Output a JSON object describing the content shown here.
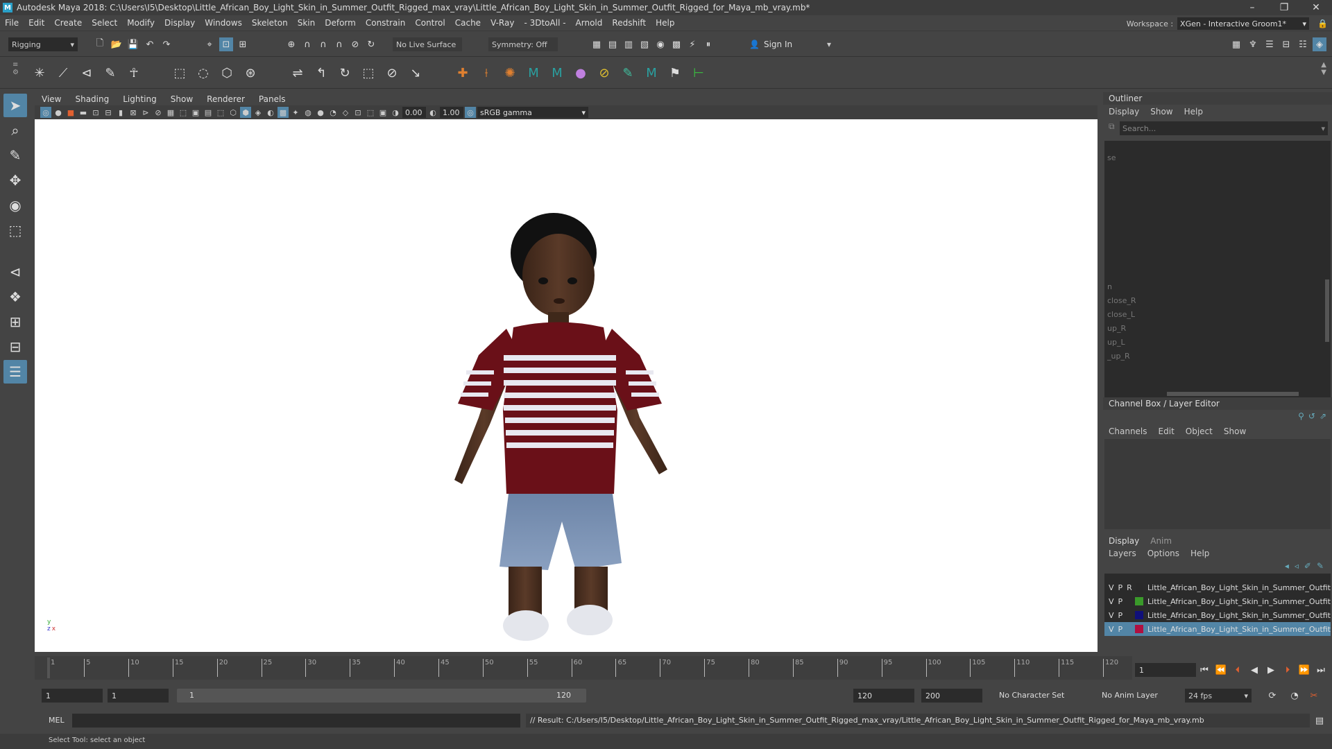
{
  "title": "Autodesk Maya 2018: C:\\Users\\I5\\Desktop\\Little_African_Boy_Light_Skin_in_Summer_Outfit_Rigged_max_vray\\Little_African_Boy_Light_Skin_in_Summer_Outfit_Rigged_for_Maya_mb_vray.mb*",
  "window_controls": {
    "minimize": "–",
    "restore": "❐",
    "close": "✕"
  },
  "menu": [
    "File",
    "Edit",
    "Create",
    "Select",
    "Modify",
    "Display",
    "Windows",
    "Skeleton",
    "Skin",
    "Deform",
    "Constrain",
    "Control",
    "Cache",
    "V-Ray",
    "- 3DtoAll -",
    "Arnold",
    "Redshift",
    "Help"
  ],
  "workspace": {
    "label": "Workspace :",
    "value": "XGen - Interactive Groom1*"
  },
  "status": {
    "mode": "Rigging",
    "live_surface": "No Live Surface",
    "symmetry": "Symmetry: Off",
    "sign_in": "Sign In"
  },
  "panel_menu": [
    "View",
    "Shading",
    "Lighting",
    "Show",
    "Renderer",
    "Panels"
  ],
  "panel_tools": {
    "exposure": "0.00",
    "gamma": "1.00",
    "color_space": "sRGB gamma"
  },
  "outliner": {
    "title": "Outliner",
    "menu": [
      "Display",
      "Show",
      "Help"
    ],
    "search_placeholder": "Search...",
    "items": [
      "se",
      "n",
      "close_R",
      "close_L",
      "up_R",
      "up_L",
      "_up_R"
    ]
  },
  "channel_box": {
    "title": "Channel Box / Layer Editor",
    "menu": [
      "Channels",
      "Edit",
      "Object",
      "Show"
    ]
  },
  "layer_editor": {
    "tabs": [
      "Display",
      "Anim"
    ],
    "menu": [
      "Layers",
      "Options",
      "Help"
    ],
    "layers": [
      {
        "v": "V",
        "p": "P",
        "r": "R",
        "name": "Little_African_Boy_Light_Skin_in_Summer_Outfit",
        "color": "#2a2a2a"
      },
      {
        "v": "V",
        "p": "P",
        "r": "",
        "name": "Little_African_Boy_Light_Skin_in_Summer_Outfit",
        "color": "#3a9a2a"
      },
      {
        "v": "V",
        "p": "P",
        "r": "",
        "name": "Little_African_Boy_Light_Skin_in_Summer_Outfit",
        "color": "#10107a"
      },
      {
        "v": "V",
        "p": "P",
        "r": "",
        "name": "Little_African_Boy_Light_Skin_in_Summer_Outfit",
        "color": "#b01040"
      }
    ]
  },
  "timeline": {
    "ticks": [
      "1",
      "5",
      "10",
      "15",
      "20",
      "25",
      "30",
      "35",
      "40",
      "45",
      "50",
      "55",
      "60",
      "65",
      "70",
      "75",
      "80",
      "85",
      "90",
      "95",
      "100",
      "105",
      "110",
      "115",
      "120"
    ],
    "current_frame": "1"
  },
  "range": {
    "start": "1",
    "playback_start": "1",
    "slider_start": "1",
    "slider_end": "120",
    "playback_end": "120",
    "end": "200",
    "character_set": "No Character Set",
    "anim_layer": "No Anim Layer",
    "fps": "24 fps"
  },
  "command": {
    "lang": "MEL",
    "result": "// Result: C:/Users/I5/Desktop/Little_African_Boy_Light_Skin_in_Summer_Outfit_Rigged_max_vray/Little_African_Boy_Light_Skin_in_Summer_Outfit_Rigged_for_Maya_mb_vray.mb"
  },
  "help_line": "Select Tool: select an object",
  "axis": {
    "y": "y",
    "x": "x",
    "z": "z"
  }
}
